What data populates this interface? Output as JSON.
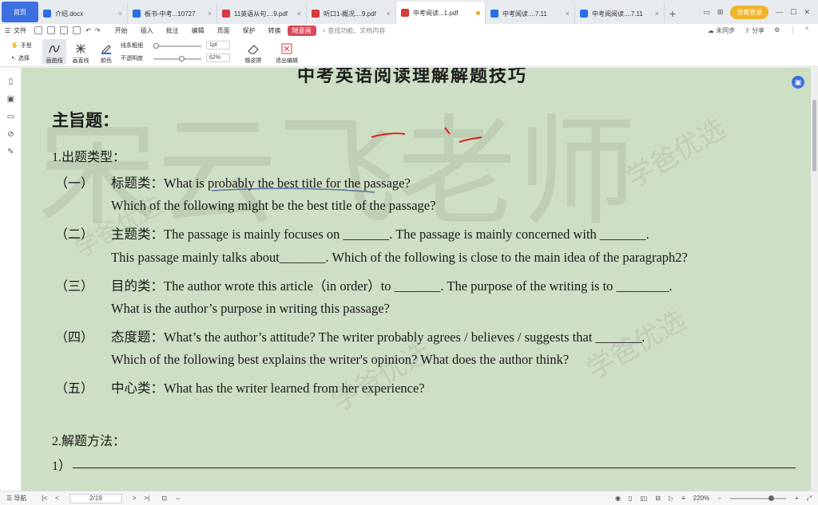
{
  "tabs": {
    "home": "首页",
    "items": [
      {
        "label": "介绍.docx",
        "type": "w"
      },
      {
        "label": "板书-中考...10727",
        "type": "w"
      },
      {
        "label": "11英语从句....9.pdf",
        "type": "p"
      },
      {
        "label": "听口1-概况....9.pdf",
        "type": "p"
      },
      {
        "label": "中考阅读...1.pdf",
        "type": "p",
        "active": true
      },
      {
        "label": "中考阅读....7.11",
        "type": "w"
      },
      {
        "label": "中考阅阅读....7.11",
        "type": "w"
      }
    ],
    "login": "访客登录"
  },
  "menu": {
    "file": "文件",
    "items": [
      "开始",
      "插入",
      "批注",
      "编辑",
      "页面",
      "保护",
      "转换",
      "随意画"
    ],
    "active": "随意画",
    "search": "查找功能、文档内容",
    "sync": "未同步",
    "share": "分享"
  },
  "ribbon": {
    "hand": "手型",
    "select": "选择",
    "draw_curve": "画曲线",
    "draw_line": "画直线",
    "color": "颜色",
    "line_width": "线条粗细",
    "opacity": "不透明度",
    "width_value": "1pt",
    "opacity_value": "62%",
    "eraser": "橡皮擦",
    "exit": "退出编辑"
  },
  "document": {
    "title": "中考英语阅读理解解题技巧",
    "main_heading": "主旨题：",
    "section1": "1.出题类型：",
    "rows": [
      {
        "num": "（一）",
        "cat": "标题类：",
        "text": "What is probably the best title for the passage?"
      },
      {
        "text2": "Which of the following might be the best title of the passage?"
      },
      {
        "num": "（二）",
        "cat": "主题类：",
        "text": "The passage is mainly focuses on _______.     The passage is mainly concerned with _______."
      },
      {
        "text2": "This passage mainly talks about_______.     Which of the following is close to the main idea of the paragraph2?"
      },
      {
        "num": "（三）",
        "cat": "目的类：",
        "text": "The author wrote this article（in order）to _______.     The purpose of the writing is to ________."
      },
      {
        "text2": "What is the author’s purpose in writing this passage?"
      },
      {
        "num": "（四）",
        "cat": "态度题：",
        "text": "What’s the author’s attitude?      The writer probably agrees / believes / suggests that _______."
      },
      {
        "text2": "Which of the following best explains the writer's opinion?      What does the author think?"
      },
      {
        "num": "（五）",
        "cat": "中心类：",
        "text": "What has the writer learned from her experience?"
      }
    ],
    "section2": "2.解题方法：",
    "answer_num": "1）"
  },
  "watermark": {
    "main": "学爸优选",
    "big": "宋云飞老师"
  },
  "status": {
    "nav": "导航",
    "page": "2/19",
    "zoom": "220%"
  },
  "colors": {
    "accent": "#3d6fe0",
    "active_menu": "#d9485b",
    "page_bg": "#cddfc4"
  }
}
